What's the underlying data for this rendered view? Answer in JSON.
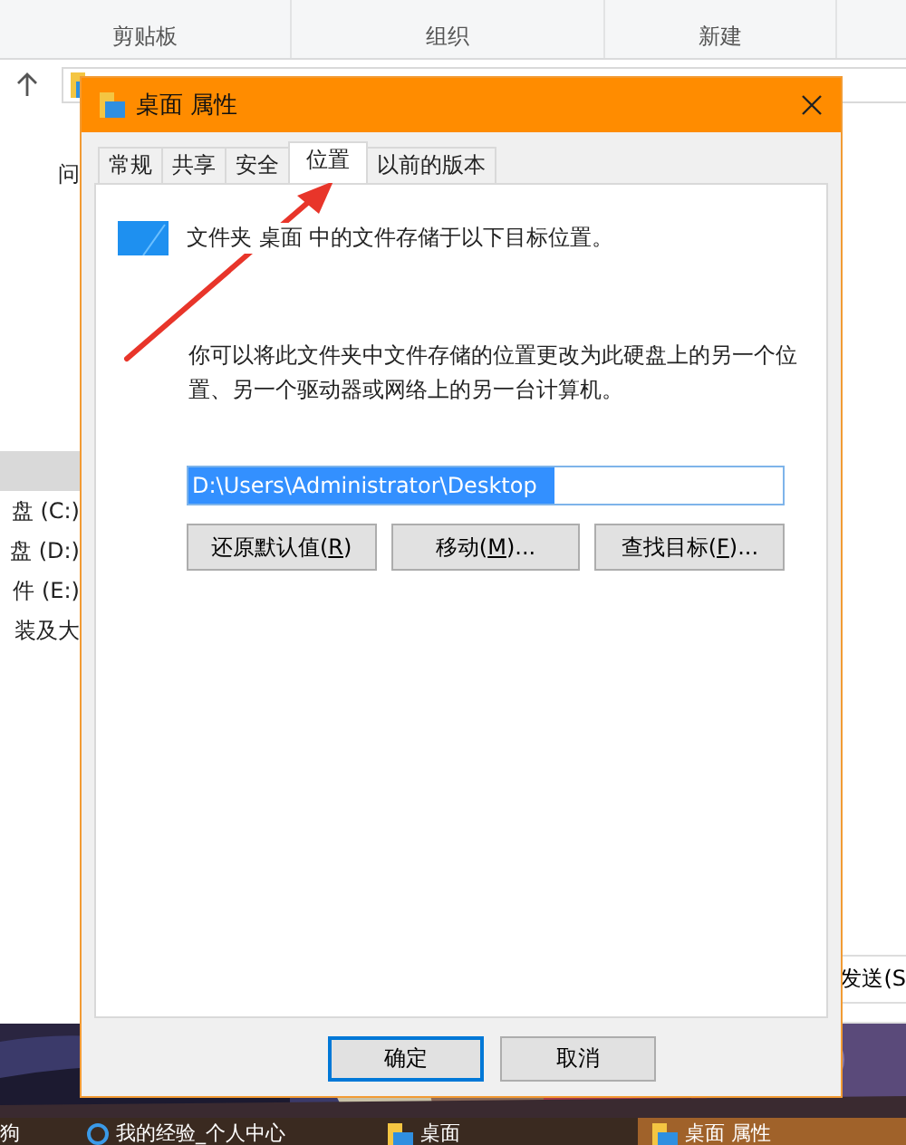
{
  "explorer": {
    "ribbon": {
      "groups": [
        "剪贴板",
        "组织",
        "新建"
      ]
    },
    "nav_items": [
      {
        "label": "问",
        "selected": false
      },
      {
        "selected": true
      },
      {
        "label": "盘 (C:)",
        "selected": false
      },
      {
        "label": "盘 (D:)",
        "selected": false
      },
      {
        "label": "件 (E:)",
        "selected": false
      },
      {
        "label": "装及大",
        "selected": false
      }
    ],
    "send_button": "发送(S"
  },
  "dialog": {
    "title": "桌面 属性",
    "tabs": [
      {
        "label": "常规",
        "selected": false
      },
      {
        "label": "共享",
        "selected": false
      },
      {
        "label": "安全",
        "selected": false
      },
      {
        "label": "位置",
        "selected": true
      },
      {
        "label": "以前的版本",
        "selected": false
      }
    ],
    "description": "文件夹 桌面 中的文件存储于以下目标位置。",
    "info": "你可以将此文件夹中文件存储的位置更改为此硬盘上的另一个位置、另一个驱动器或网络上的另一台计算机。",
    "path": "D:\\Users\\Administrator\\Desktop",
    "actions": [
      {
        "before": "还原默认值(",
        "key": "R",
        "after": ")"
      },
      {
        "before": "移动(",
        "key": "M",
        "after": ")..."
      },
      {
        "before": "查找目标(",
        "key": "F",
        "after": ")..."
      }
    ],
    "footer_buttons": [
      {
        "label": "确定",
        "default": true
      },
      {
        "label": "取消",
        "default": false
      }
    ]
  },
  "taskbar": [
    {
      "kind": "text",
      "label": "狗",
      "selected": false
    },
    {
      "kind": "browser",
      "label": "我的经验_个人中心",
      "selected": false
    },
    {
      "kind": "folder",
      "label": "桌面",
      "selected": false
    },
    {
      "kind": "folder",
      "label": "桌面 属性",
      "selected": true
    }
  ]
}
